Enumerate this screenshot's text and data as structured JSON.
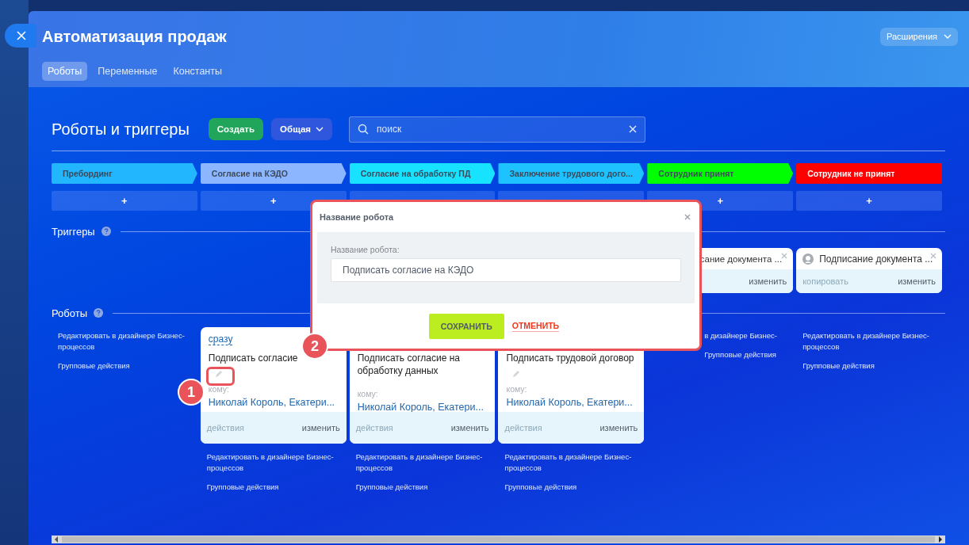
{
  "window": {
    "title": "Автоматизация продаж",
    "extensions_button": "Расширения"
  },
  "tabs": [
    {
      "label": "Роботы",
      "selected": true
    },
    {
      "label": "Переменные",
      "selected": false
    },
    {
      "label": "Константы",
      "selected": false
    }
  ],
  "toolbar": {
    "title": "Роботы и триггеры",
    "create_button": "Создать",
    "category_button": "Общая",
    "search": {
      "placeholder": "поиск"
    }
  },
  "stages": [
    {
      "name": "Пребординг",
      "color": "#22b6ff",
      "add": "+"
    },
    {
      "name": "Согласие на КЭДО",
      "color": "#8cb6ff",
      "add": "+"
    },
    {
      "name": "Согласие на обработку ПД",
      "color": "#17e2ff"
    },
    {
      "name": "Заключение трудового дого...",
      "color": "#1ec2ff"
    },
    {
      "name": "Сотрудник принят",
      "color": "#00ff00",
      "add": "+"
    },
    {
      "name": "Сотрудник не принят",
      "color": "#ff0000",
      "add": "+"
    }
  ],
  "triggers": {
    "title": "Триггеры",
    "columns": [
      {},
      {},
      {},
      {},
      {
        "cards": [
          {
            "name": "сание документа ...",
            "has_icon": false,
            "actions": [
              "изменить"
            ]
          }
        ]
      },
      {
        "cards": [
          {
            "name": "Подписание документа ...",
            "has_icon": true,
            "actions": [
              "копировать",
              "изменить"
            ]
          }
        ]
      }
    ]
  },
  "robots": {
    "title": "Роботы",
    "columns": [
      {
        "links": [
          "Редактировать в дизайнере Бизнес-процессов",
          "Групповые действия"
        ]
      },
      {
        "cards": [
          {
            "delay": "сразу",
            "name": "Подписать согласие",
            "to_label": "кому:",
            "recipients": "Николай Король, Екатери...",
            "actions": [
              "действия",
              "изменить"
            ]
          }
        ],
        "links": [
          "Редактировать в дизайнере Бизнес-процессов",
          "Групповые действия"
        ]
      },
      {
        "cards": [
          {
            "name": "Подписать согласие на обработку данных",
            "to_label": "кому:",
            "recipients": "Николай Король, Екатери...",
            "actions": [
              "действия",
              "изменить"
            ]
          }
        ],
        "links": [
          "Редактировать в дизайнере Бизнес-процессов",
          "Групповые действия"
        ]
      },
      {
        "cards": [
          {
            "name": "Подписать трудовой договор",
            "to_label": "кому:",
            "recipients": "Николай Король, Екатери...",
            "actions": [
              "действия",
              "изменить"
            ]
          }
        ],
        "links": [
          "Редактировать в дизайнере Бизнес-процессов",
          "Групповые действия"
        ]
      },
      {
        "covered": true,
        "links": [
          "в дизайнере Бизнес-",
          "Групповые действия"
        ]
      },
      {
        "links": [
          "Редактировать в дизайнере Бизнес-процессов",
          "Групповые действия"
        ]
      }
    ]
  },
  "dialog": {
    "title": "Название робота",
    "field_label": "Название робота:",
    "field_value": "Подписать согласие на КЭДО",
    "save_button": "СОХРАНИТЬ",
    "cancel_button": "ОТМЕНИТЬ"
  },
  "callouts": [
    "1",
    "2"
  ]
}
